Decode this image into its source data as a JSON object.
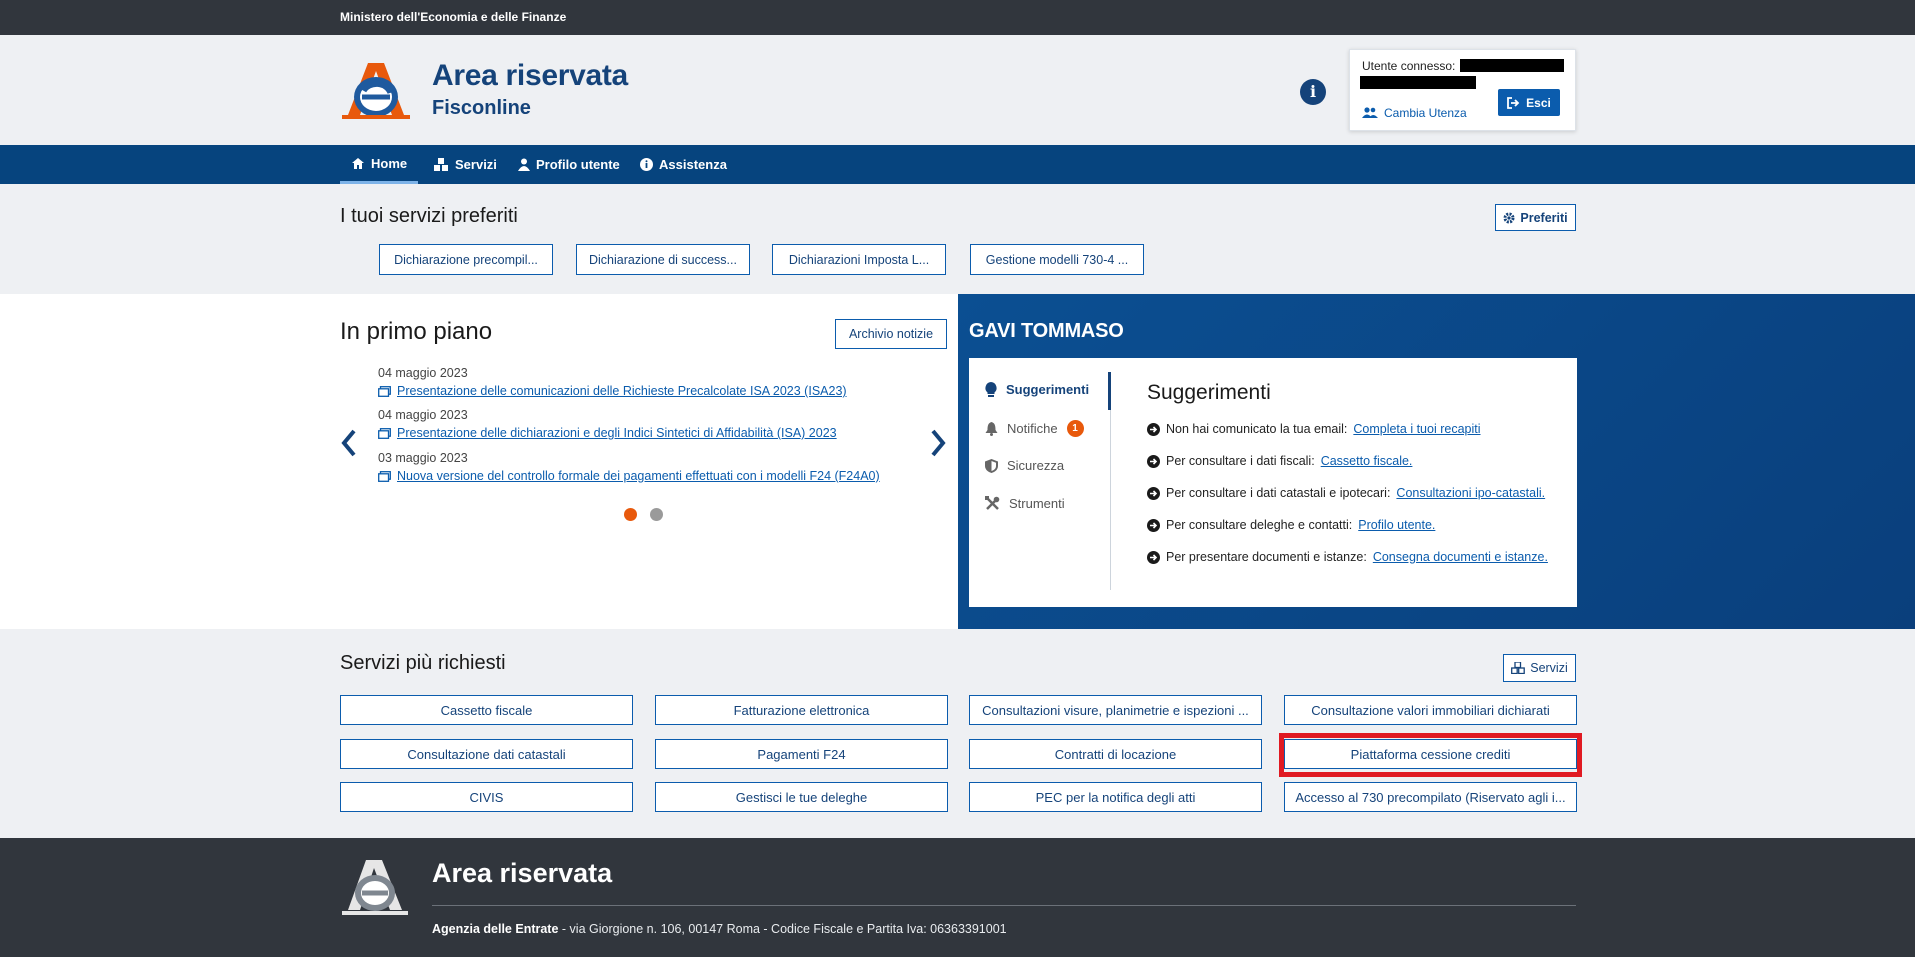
{
  "topbar": {
    "ministry": "Ministero dell'Economia e delle Finanze"
  },
  "header": {
    "title": "Area riservata",
    "subtitle": "Fisconline",
    "user_label": "Utente connesso:",
    "switch_user": "Cambia Utenza",
    "logout": "Esci"
  },
  "nav": {
    "items": [
      "Home",
      "Servizi",
      "Profilo utente",
      "Assistenza"
    ]
  },
  "favorites": {
    "title": "I tuoi servizi preferiti",
    "settings_button": "Preferiti",
    "items": [
      "Dichiarazione precompil...",
      "Dichiarazione di success...",
      "Dichiarazioni Imposta L...",
      "Gestione modelli 730-4 ..."
    ]
  },
  "featured": {
    "title": "In primo piano",
    "archive_button": "Archivio notizie",
    "news": [
      {
        "date": "04 maggio 2023",
        "text": "Presentazione delle comunicazioni delle Richieste Precalcolate ISA 2023 (ISA23)"
      },
      {
        "date": "04 maggio 2023",
        "text": "Presentazione delle dichiarazioni e degli Indici Sintetici di Affidabilità (ISA) 2023"
      },
      {
        "date": "03 maggio 2023",
        "text": "Nuova versione del controllo formale dei pagamenti effettuati con i modelli F24 (F24A0)"
      }
    ]
  },
  "profile": {
    "name": "GAVI TOMMASO",
    "tabs": [
      "Suggerimenti",
      "Notifiche",
      "Sicurezza",
      "Strumenti"
    ],
    "notifications_count": "1",
    "suggestions_title": "Suggerimenti",
    "suggestions": [
      {
        "text": "Non hai comunicato la tua email:",
        "link": "Completa i tuoi recapiti"
      },
      {
        "text": "Per consultare i dati fiscali:",
        "link": "Cassetto fiscale."
      },
      {
        "text": "Per consultare i dati catastali e ipotecari:",
        "link": "Consultazioni ipo-catastali."
      },
      {
        "text": "Per consultare deleghe e contatti:",
        "link": "Profilo utente."
      },
      {
        "text": "Per presentare documenti e istanze:",
        "link": "Consegna documenti e istanze."
      }
    ]
  },
  "services": {
    "title": "Servizi più richiesti",
    "button": "Servizi",
    "items": [
      "Cassetto fiscale",
      "Fatturazione elettronica",
      "Consultazioni visure, planimetrie e ispezioni ...",
      "Consultazione valori immobiliari dichiarati",
      "Consultazione dati catastali",
      "Pagamenti F24",
      "Contratti di locazione",
      "Piattaforma cessione crediti",
      "CIVIS",
      "Gestisci le tue deleghe",
      "PEC per la notifica degli atti",
      "Accesso al 730 precompilato (Riservato agli i..."
    ]
  },
  "footer": {
    "title": "Area riservata",
    "agency": "Agenzia delle Entrate",
    "address": " - via Giorgione n. 106, 00147 Roma - Codice Fiscale e Partita Iva: 06363391001"
  },
  "colors": {
    "brand": "#06447e",
    "accent": "#e8590c",
    "highlight": "#e01a22"
  }
}
